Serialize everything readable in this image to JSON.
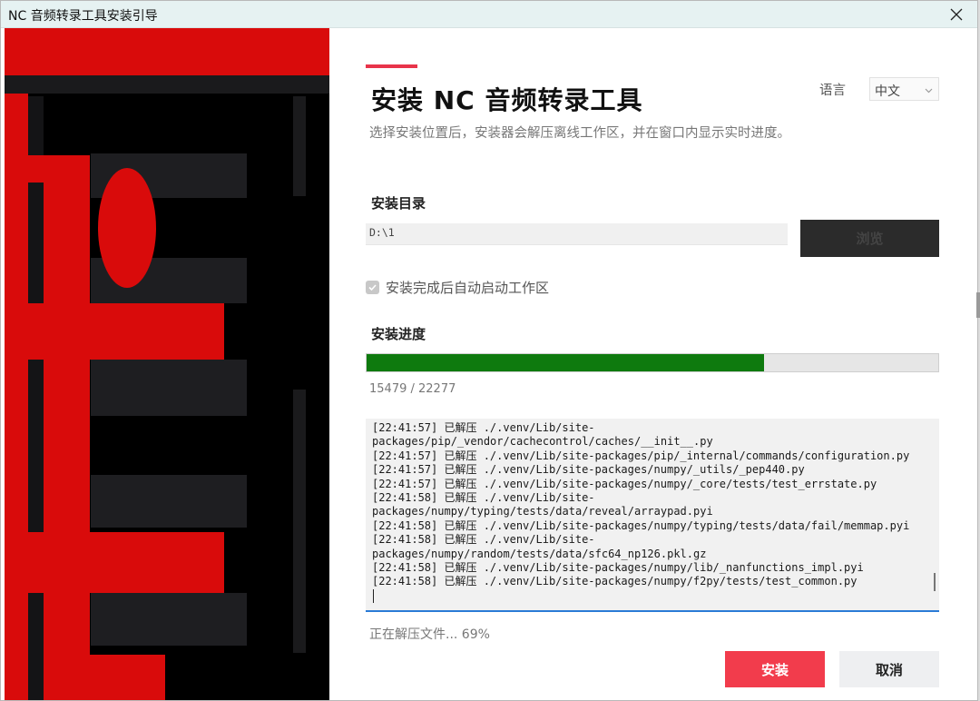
{
  "window": {
    "title": "NC 音频转录工具安装引导",
    "close_icon": "close-icon"
  },
  "header": {
    "title": "安装 NC 音频转录工具",
    "subtitle": "选择安装位置后，安装器会解压离线工作区，并在窗口内显示实时进度。",
    "language_label": "语言",
    "language_value": "中文"
  },
  "install_dir": {
    "label": "安装目录",
    "value": "D:\\1",
    "browse_label": "浏览"
  },
  "autostart": {
    "label": "安装完成后自动启动工作区",
    "checked": true
  },
  "progress": {
    "label": "安装进度",
    "count_text": "15479 / 22277",
    "current": 15479,
    "total": 22277,
    "fraction": 0.6948
  },
  "log": {
    "lines": [
      "[22:41:57] 已解压 ./.venv/Lib/site-",
      "packages/pip/_vendor/cachecontrol/caches/__init__.py",
      "[22:41:57] 已解压 ./.venv/Lib/site-packages/pip/_internal/commands/configuration.py",
      "[22:41:57] 已解压 ./.venv/Lib/site-packages/numpy/_utils/_pep440.py",
      "[22:41:57] 已解压 ./.venv/Lib/site-packages/numpy/_core/tests/test_errstate.py",
      "[22:41:58] 已解压 ./.venv/Lib/site-",
      "packages/numpy/typing/tests/data/reveal/arraypad.pyi",
      "[22:41:58] 已解压 ./.venv/Lib/site-packages/numpy/typing/tests/data/fail/memmap.pyi",
      "[22:41:58] 已解压 ./.venv/Lib/site-",
      "packages/numpy/random/tests/data/sfc64_np126.pkl.gz",
      "[22:41:58] 已解压 ./.venv/Lib/site-packages/numpy/lib/_nanfunctions_impl.pyi",
      "[22:41:58] 已解压 ./.venv/Lib/site-packages/numpy/f2py/tests/test_common.py"
    ]
  },
  "status_text": "正在解压文件... 69%",
  "buttons": {
    "install": "安装",
    "cancel": "取消"
  },
  "colors": {
    "accent": "#e8344a",
    "install_button": "#f23c4c",
    "progress_fill": "#0e7a0e",
    "browse_button": "#2b2b2b",
    "log_border": "#2a7bd6"
  }
}
